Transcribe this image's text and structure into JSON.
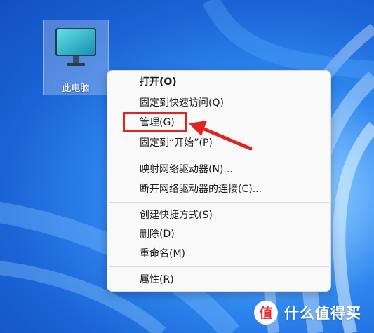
{
  "desktop": {
    "icon": {
      "name": "computer-icon",
      "label": "此电脑"
    }
  },
  "context_menu": {
    "items": [
      {
        "label": "打开(O)"
      },
      {
        "label": "固定到快速访问(Q)"
      },
      {
        "label": "管理(G)"
      },
      {
        "label": "固定到“开始”(P)"
      },
      {
        "label": "映射网络驱动器(N)..."
      },
      {
        "label": "断开网络驱动器的连接(C)..."
      },
      {
        "label": "创建快捷方式(S)"
      },
      {
        "label": "删除(D)"
      },
      {
        "label": "重命名(M)"
      },
      {
        "label": "属性(R)"
      }
    ],
    "highlighted_item": "管理(G)"
  },
  "annotation": {
    "highlight_color": "#e02424",
    "arrow_color": "#e02424"
  },
  "watermark": {
    "text": "什么值得买",
    "logo": "smzdm-logo-icon",
    "logo_glyph": "值"
  }
}
